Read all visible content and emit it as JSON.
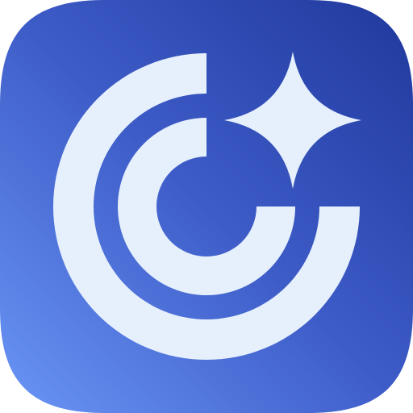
{
  "app_icon": {
    "icon_name": "concentric-arcs-sparkle-app-icon",
    "colors": {
      "background_top_right": "#1F389C",
      "background_mid": "#3E5CC8",
      "background_bottom_left": "#6A96F6",
      "glyph": "#E6F0FC",
      "page": "#FFFFFF"
    }
  }
}
